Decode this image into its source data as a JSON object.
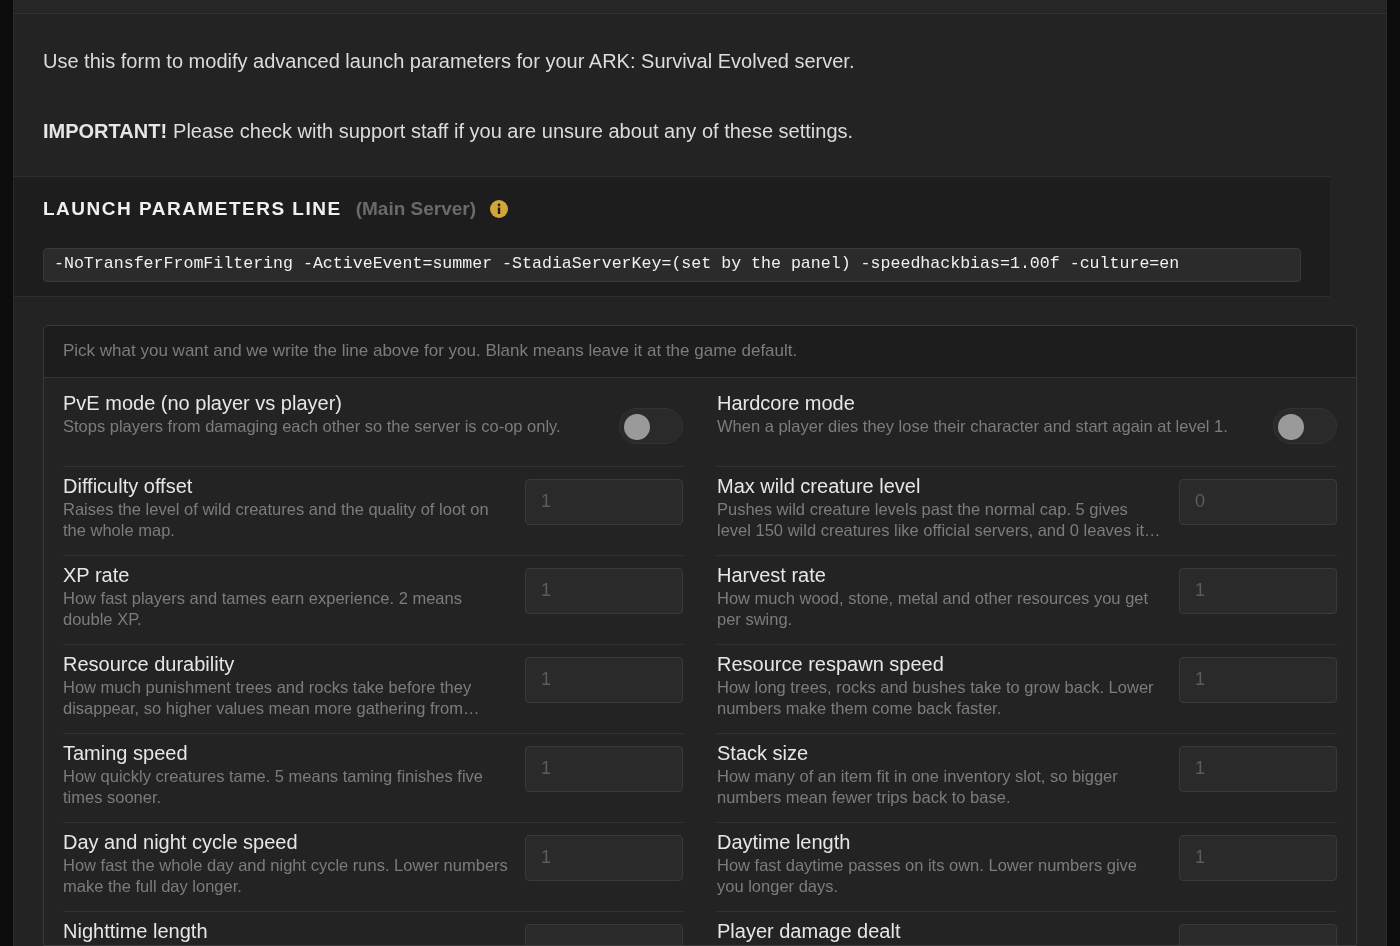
{
  "intro": {
    "text": "Use this form to modify advanced launch parameters for your ARK: Survival Evolved server.",
    "important_label": "IMPORTANT!",
    "important_text": "Please check with support staff if you are unsure about any of these settings."
  },
  "launch": {
    "title": "LAUNCH PARAMETERS LINE",
    "subtitle": "(Main Server)",
    "line": "-NoTransferFromFiltering -ActiveEvent=summer -StadiaServerKey=(set by the panel) -speedhackbias=1.00f -culture=en"
  },
  "form": {
    "hint": "Pick what you want and we write the line above for you. Blank means leave it at the game default.",
    "settings": [
      {
        "kind": "toggle",
        "label": "PvE mode (no player vs player)",
        "description": "Stops players from damaging each other so the server is co-op only.",
        "on": false
      },
      {
        "kind": "toggle",
        "label": "Hardcore mode",
        "description": "When a player dies they lose their character and start again at level 1.",
        "on": false
      },
      {
        "kind": "number",
        "label": "Difficulty offset",
        "description": "Raises the level of wild creatures and the quality of loot on the whole map.",
        "placeholder": "1"
      },
      {
        "kind": "number",
        "label": "Max wild creature level",
        "description": "Pushes wild creature levels past the normal cap. 5 gives level 150 wild creatures like official servers, and 0 leaves it…",
        "placeholder": "0"
      },
      {
        "kind": "number",
        "label": "XP rate",
        "description": "How fast players and tames earn experience. 2 means double XP.",
        "placeholder": "1"
      },
      {
        "kind": "number",
        "label": "Harvest rate",
        "description": "How much wood, stone, metal and other resources you get per swing.",
        "placeholder": "1"
      },
      {
        "kind": "number",
        "label": "Resource durability",
        "description": "How much punishment trees and rocks take before they disappear, so higher values mean more gathering from…",
        "placeholder": "1"
      },
      {
        "kind": "number",
        "label": "Resource respawn speed",
        "description": "How long trees, rocks and bushes take to grow back. Lower numbers make them come back faster.",
        "placeholder": "1"
      },
      {
        "kind": "number",
        "label": "Taming speed",
        "description": "How quickly creatures tame. 5 means taming finishes five times sooner.",
        "placeholder": "1"
      },
      {
        "kind": "number",
        "label": "Stack size",
        "description": "How many of an item fit in one inventory slot, so bigger numbers mean fewer trips back to base.",
        "placeholder": "1"
      },
      {
        "kind": "number",
        "label": "Day and night cycle speed",
        "description": "How fast the whole day and night cycle runs. Lower numbers make the full day longer.",
        "placeholder": "1"
      },
      {
        "kind": "number",
        "label": "Daytime length",
        "description": "How fast daytime passes on its own. Lower numbers give you longer days.",
        "placeholder": "1"
      },
      {
        "kind": "number",
        "label": "Nighttime length"
      },
      {
        "kind": "number",
        "label": "Player damage dealt"
      }
    ]
  }
}
